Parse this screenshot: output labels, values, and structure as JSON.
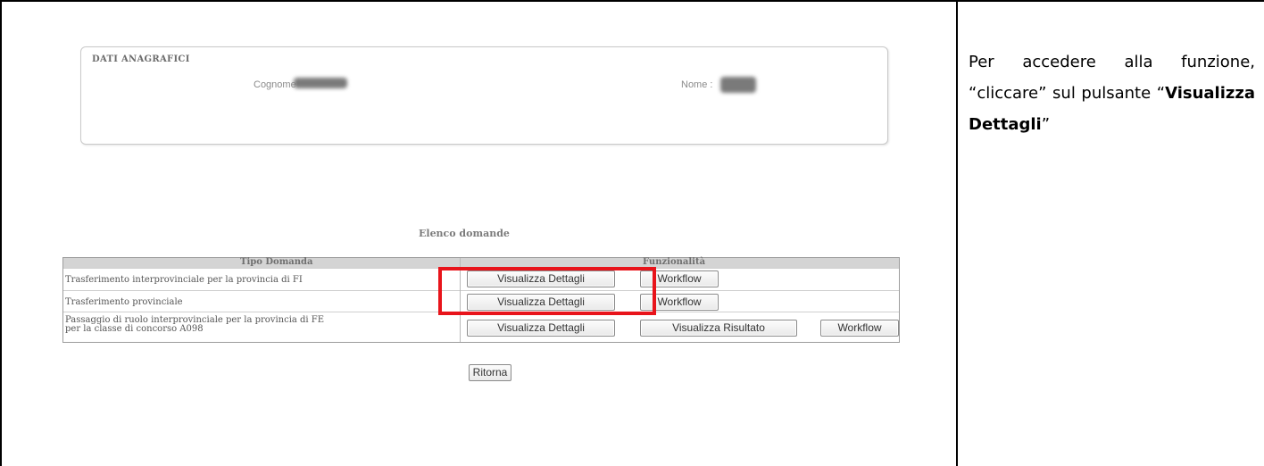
{
  "anagrafica": {
    "title": "DATI ANAGRAFICI",
    "cognome_label": "Cognome",
    "nome_label": "Nome :"
  },
  "elenco": {
    "title": "Elenco domande",
    "headers": {
      "tipo": "Tipo Domanda",
      "funzionalita": "Funzionalità"
    },
    "rows": [
      {
        "tipo": "Trasferimento interprovinciale per la provincia di FI",
        "buttons": [
          "Visualizza Dettagli",
          "Workflow"
        ]
      },
      {
        "tipo": "Trasferimento provinciale",
        "buttons": [
          "Visualizza Dettagli",
          "Workflow"
        ]
      },
      {
        "tipo_line1": "Passaggio di ruolo interprovinciale per la provincia di FE",
        "tipo_line2": "per la classe di concorso A098",
        "buttons": [
          "Visualizza Dettagli",
          "Visualizza Risultato",
          "Workflow"
        ]
      }
    ]
  },
  "ritorna_label": "Ritorna",
  "highlight_color": "#e8141b",
  "note": {
    "part1": "Per accedere alla funzione, “cliccare” sul pulsante “",
    "bold": "Visualizza Dettagli",
    "part2": "”"
  }
}
